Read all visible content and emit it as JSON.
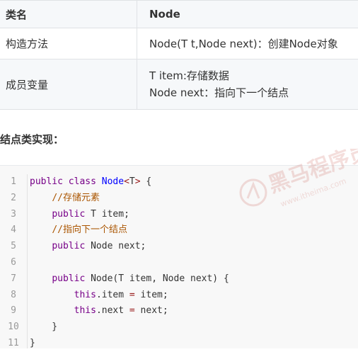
{
  "table": {
    "header": {
      "col1": "类名",
      "col2": "Node"
    },
    "rows": [
      {
        "label": "构造方法",
        "lines": [
          "Node(T t,Node next)：创建Node对象"
        ]
      },
      {
        "label": "成员变量",
        "lines": [
          "T item:存储数据",
          "Node next：指向下一个结点"
        ]
      }
    ]
  },
  "section_title": "结点类实现：",
  "code": {
    "line_numbers": [
      "1",
      "2",
      "3",
      "4",
      "5",
      "6",
      "7",
      "8",
      "9",
      "10",
      "11"
    ],
    "lines": [
      [
        {
          "t": "public ",
          "c": "kw"
        },
        {
          "t": "class ",
          "c": "kw"
        },
        {
          "t": "Node",
          "c": "ty"
        },
        {
          "t": "<",
          "c": "op"
        },
        {
          "t": "T",
          "c": ""
        },
        {
          "t": ">",
          "c": "op"
        },
        {
          "t": " {",
          "c": ""
        }
      ],
      [
        {
          "t": "    ",
          "c": ""
        },
        {
          "t": "//存储元素",
          "c": "cm"
        }
      ],
      [
        {
          "t": "    ",
          "c": ""
        },
        {
          "t": "public ",
          "c": "kw"
        },
        {
          "t": "T item;",
          "c": ""
        }
      ],
      [
        {
          "t": "    ",
          "c": ""
        },
        {
          "t": "//指向下一个结点",
          "c": "cm"
        }
      ],
      [
        {
          "t": "    ",
          "c": ""
        },
        {
          "t": "public ",
          "c": "kw"
        },
        {
          "t": "Node next;",
          "c": ""
        }
      ],
      [
        {
          "t": "",
          "c": ""
        }
      ],
      [
        {
          "t": "    ",
          "c": ""
        },
        {
          "t": "public ",
          "c": "kw"
        },
        {
          "t": "Node(T item, Node next) {",
          "c": ""
        }
      ],
      [
        {
          "t": "        ",
          "c": ""
        },
        {
          "t": "this",
          "c": "kw"
        },
        {
          "t": ".item ",
          "c": ""
        },
        {
          "t": "=",
          "c": "op"
        },
        {
          "t": " item;",
          "c": ""
        }
      ],
      [
        {
          "t": "        ",
          "c": ""
        },
        {
          "t": "this",
          "c": "kw"
        },
        {
          "t": ".next ",
          "c": ""
        },
        {
          "t": "=",
          "c": "op"
        },
        {
          "t": " next;",
          "c": ""
        }
      ],
      [
        {
          "t": "    }",
          "c": ""
        }
      ],
      [
        {
          "t": "}",
          "c": ""
        }
      ]
    ]
  },
  "watermark": {
    "text": "黑马程序员",
    "url_text": "www.itheima.com"
  }
}
